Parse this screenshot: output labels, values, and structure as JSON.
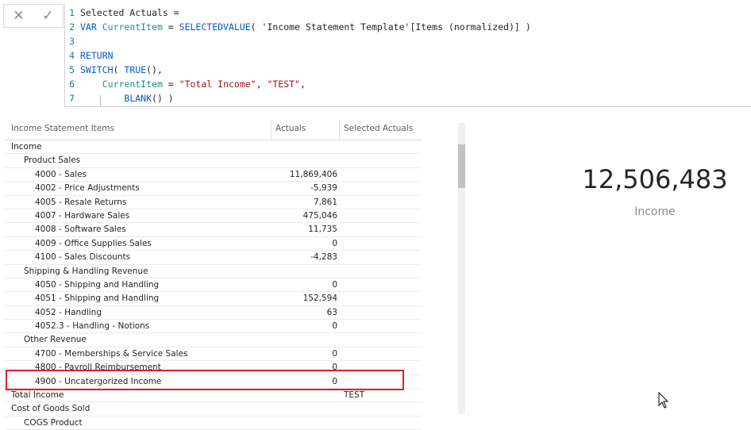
{
  "formula": {
    "cancel_icon": "✕",
    "confirm_icon": "✓",
    "lines": [
      {
        "n": "1",
        "parts": [
          {
            "t": "Selected Actuals =",
            "c": "plain"
          }
        ]
      },
      {
        "n": "2",
        "parts": [
          {
            "t": "VAR ",
            "c": "kw"
          },
          {
            "t": "CurrentItem",
            "c": "var"
          },
          {
            "t": " = ",
            "c": "plain"
          },
          {
            "t": "SELECTEDVALUE",
            "c": "fn"
          },
          {
            "t": "( 'Income Statement Template'[Items (normalized)] )",
            "c": "plain"
          }
        ]
      },
      {
        "n": "3",
        "parts": []
      },
      {
        "n": "4",
        "parts": [
          {
            "t": "RETURN",
            "c": "kw"
          }
        ]
      },
      {
        "n": "5",
        "parts": [
          {
            "t": "SWITCH",
            "c": "fn"
          },
          {
            "t": "( ",
            "c": "plain"
          },
          {
            "t": "TRUE",
            "c": "fn"
          },
          {
            "t": "(),",
            "c": "plain"
          }
        ]
      },
      {
        "n": "6",
        "parts": [
          {
            "t": "    ",
            "c": "plain"
          },
          {
            "t": "CurrentItem",
            "c": "var"
          },
          {
            "t": " = ",
            "c": "plain"
          },
          {
            "t": "\"Total Income\"",
            "c": "str"
          },
          {
            "t": ", ",
            "c": "plain"
          },
          {
            "t": "\"TEST\"",
            "c": "str"
          },
          {
            "t": ",",
            "c": "plain"
          }
        ]
      },
      {
        "n": "7",
        "parts": [
          {
            "t": "        ",
            "c": "plain"
          },
          {
            "t": "BLANK",
            "c": "fn"
          },
          {
            "t": "() )",
            "c": "plain"
          }
        ]
      }
    ]
  },
  "table": {
    "headers": [
      "Income Statement Items",
      "Actuals",
      "Selected Actuals"
    ],
    "rows": [
      {
        "label": "Income",
        "indent": 0,
        "actual": "",
        "selected": ""
      },
      {
        "label": "Product Sales",
        "indent": 1,
        "actual": "",
        "selected": ""
      },
      {
        "label": "4000 - Sales",
        "indent": 2,
        "actual": "11,869,406",
        "selected": ""
      },
      {
        "label": "4002 - Price Adjustments",
        "indent": 2,
        "actual": "-5,939",
        "selected": ""
      },
      {
        "label": "4005 - Resale Returns",
        "indent": 2,
        "actual": "7,861",
        "selected": ""
      },
      {
        "label": "4007 - Hardware Sales",
        "indent": 2,
        "actual": "475,046",
        "selected": ""
      },
      {
        "label": "4008 - Software Sales",
        "indent": 2,
        "actual": "11,735",
        "selected": ""
      },
      {
        "label": "4009 - Office Supplies Sales",
        "indent": 2,
        "actual": "0",
        "selected": ""
      },
      {
        "label": "4100 - Sales Discounts",
        "indent": 2,
        "actual": "-4,283",
        "selected": ""
      },
      {
        "label": "Shipping & Handling Revenue",
        "indent": 1,
        "actual": "",
        "selected": ""
      },
      {
        "label": "4050 - Shipping and Handling",
        "indent": 2,
        "actual": "0",
        "selected": ""
      },
      {
        "label": "4051 - Shipping and Handling",
        "indent": 2,
        "actual": "152,594",
        "selected": ""
      },
      {
        "label": "4052 - Handling",
        "indent": 2,
        "actual": "63",
        "selected": ""
      },
      {
        "label": "4052.3 - Handling - Notions",
        "indent": 2,
        "actual": "0",
        "selected": ""
      },
      {
        "label": "Other Revenue",
        "indent": 1,
        "actual": "",
        "selected": ""
      },
      {
        "label": "4700 - Memberships & Service Sales",
        "indent": 2,
        "actual": "0",
        "selected": ""
      },
      {
        "label": "4800 - Payroll Reimbursement",
        "indent": 2,
        "actual": "0",
        "selected": ""
      },
      {
        "label": "4900 - Uncatergorized Income",
        "indent": 2,
        "actual": "0",
        "selected": ""
      },
      {
        "label": "Total Income",
        "indent": 0,
        "actual": "",
        "selected": "TEST"
      },
      {
        "label": "Cost of Goods Sold",
        "indent": 0,
        "actual": "",
        "selected": ""
      },
      {
        "label": "COGS Product",
        "indent": 1,
        "actual": "",
        "selected": ""
      }
    ]
  },
  "card": {
    "value": "12,506,483",
    "label": "Income"
  },
  "colors": {
    "highlight": "#d92128",
    "keyword": "#035aca",
    "variable": "#208c91",
    "string": "#a31515"
  }
}
